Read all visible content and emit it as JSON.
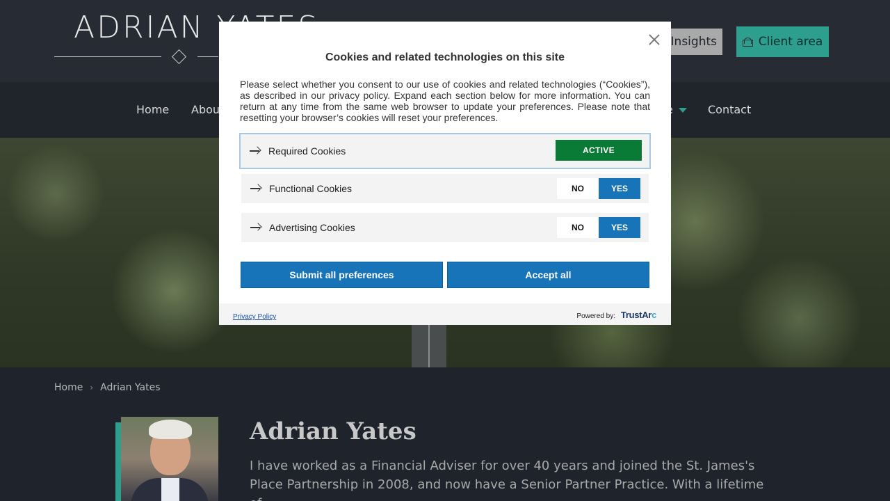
{
  "header": {
    "logo_text": "ADRIAN YATES",
    "insights_label": "Insights",
    "client_area_label": "Client area"
  },
  "nav": {
    "items": [
      "Home",
      "About",
      "e",
      "Contact"
    ]
  },
  "breadcrumb": {
    "home": "Home",
    "separator": "›",
    "current": "Adrian Yates"
  },
  "profile": {
    "name": "Adrian Yates",
    "bio": "I have worked as a Financial Adviser for over 40 years and joined the St. James's Place Partnership in 2008, and now have a Senior Partner Practice. With a lifetime of"
  },
  "cookie_modal": {
    "title": "Cookies and related technologies on this site",
    "description": "Please select whether you consent to our use of cookies and related technologies (“Cookies”), as described in our privacy policy. Expand each section below for more information. You can return at any time from the same web browser to update your preferences. Please note that resetting your browser’s cookies will reset your preferences.",
    "preferences": [
      {
        "label": "Required Cookies",
        "status": "ACTIVE"
      },
      {
        "label": "Functional Cookies",
        "no_label": "NO",
        "yes_label": "YES"
      },
      {
        "label": "Advertising Cookies",
        "no_label": "NO",
        "yes_label": "YES"
      }
    ],
    "submit_label": "Submit all preferences",
    "accept_label": "Accept all",
    "privacy_link": "Privacy Policy",
    "powered_by": "Powered by:",
    "brand_a": "TrustAr",
    "brand_b": "c"
  },
  "colors": {
    "accent_teal": "#2e9e8e",
    "button_blue": "#1774b9",
    "active_green": "#0a7a37"
  }
}
